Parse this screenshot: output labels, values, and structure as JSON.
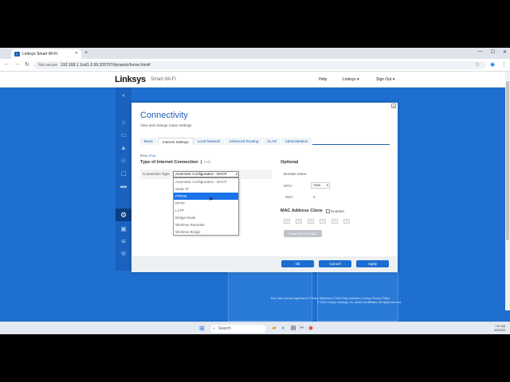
{
  "browser": {
    "tab_title": "Linksys Smart Wi-Fi",
    "tab_icon": "linksys-favicon",
    "new_tab": "+",
    "security": "Not secure",
    "url": "192.168.1.1/ui/1.0.99.209797/dynamic/home.html#"
  },
  "header": {
    "logo": "Linksys",
    "product": "Smart Wi-Fi",
    "help": "Help",
    "account": "Linksys",
    "signout": "Sign Out"
  },
  "dialog": {
    "title": "Connectivity",
    "subtitle": "View and change router settings",
    "tabs": [
      "Basic",
      "Internet Settings",
      "Local Network",
      "Advanced Routing",
      "VLAN",
      "Administration"
    ],
    "active_tab": "Internet Settings",
    "ipv4": "IPv4",
    "ipv6": "IPv6",
    "section_type": "Type of Internet Connection",
    "edit": "Edit",
    "conn_label": "Connection Type",
    "conn_value": "Automatic Configuration - DHCP",
    "options": [
      "Automatic Configuration - DHCP",
      "Static IP",
      "PPPoE",
      "PPTP",
      "L2TP",
      "Bridge Mode",
      "Wireless Repeater",
      "Wireless Bridge"
    ],
    "highlighted_option": "PPPoE",
    "optional": "Optional",
    "domain_label": "Domain name:",
    "mtu_label": "MTU:",
    "mtu_value": "Auto",
    "size_label": "Size:",
    "size_value": "0",
    "mac_clone": "MAC Address Clone",
    "enabled": "Enabled",
    "mac_octets": [
      "00",
      "00",
      "00",
      "00",
      "00",
      "00"
    ],
    "clone_btn": "Clone My PC's MAC",
    "ok": "Ok",
    "cancel": "Cancel",
    "apply": "Apply"
  },
  "footer": {
    "eula": "End User License Agreement",
    "privacy": "Privacy Statement",
    "third": "Third Party Licenses",
    "linksys_privacy": "Linksys Privacy Policy",
    "copyright": "© 2023 Linksys Holdings, Inc. and/or its affiliates. All rights reserved."
  },
  "taskbar": {
    "search": "Search",
    "time": "7:57 AM",
    "date": "4/6/2024"
  }
}
